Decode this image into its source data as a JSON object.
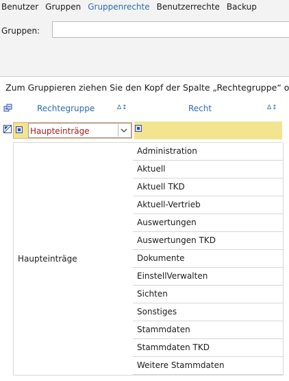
{
  "tabs": [
    {
      "label": "Benutzer",
      "active": false
    },
    {
      "label": "Gruppen",
      "active": false
    },
    {
      "label": "Gruppenrechte",
      "active": true
    },
    {
      "label": "Benutzerrechte",
      "active": false
    },
    {
      "label": "Backup",
      "active": false
    }
  ],
  "groups_field": {
    "label": "Gruppen:",
    "value": ""
  },
  "grid": {
    "group_panel_hint": "Zum Gruppieren ziehen Sie den Kopf der Spalte „Rechtegruppe“ od",
    "columns": [
      {
        "label": "Rechtegruppe",
        "sort_icon": "Δ",
        "pin_icon": "↖"
      },
      {
        "label": "Recht",
        "sort_icon": "Δ",
        "pin_icon": "↖"
      }
    ],
    "filter_value": "Haupteinträge",
    "group_value": "Haupteinträge",
    "rows": [
      "Administration",
      "Aktuell",
      "Aktuell TKD",
      "Aktuell-Vertrieb",
      "Auswertungen",
      "Auswertungen TKD",
      "Dokumente",
      "EinstellVerwalten",
      "Sichten",
      "Sonstiges",
      "Stammdaten",
      "Stammdaten TKD",
      "Weitere Stammdaten"
    ]
  },
  "colors": {
    "accent": "#2b6cb0",
    "filter_bg": "#f3e58f",
    "filter_text": "#b01818"
  }
}
